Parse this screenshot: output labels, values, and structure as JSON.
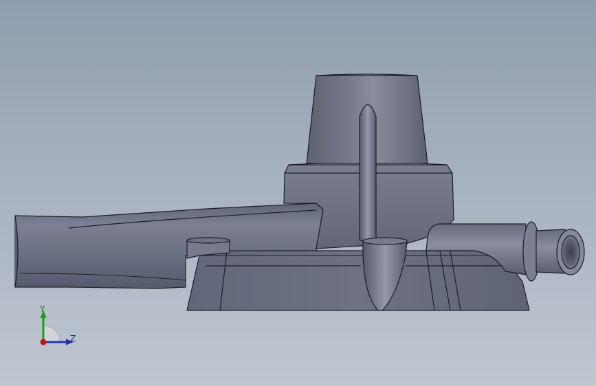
{
  "viewport": {
    "background_top": "#8f9dae",
    "background_bottom": "#bfc6d0",
    "part_color": "#6b6f80",
    "edge_color": "#1c1d24"
  },
  "model": {
    "icon": "cad-part-3d-model"
  },
  "triad": {
    "icon": "coordinate-triad-icon",
    "y_label": "Y",
    "z_label": "Z",
    "y_color": "#1f9a1f",
    "z_color": "#1f35b0",
    "origin_color": "#c01818"
  }
}
